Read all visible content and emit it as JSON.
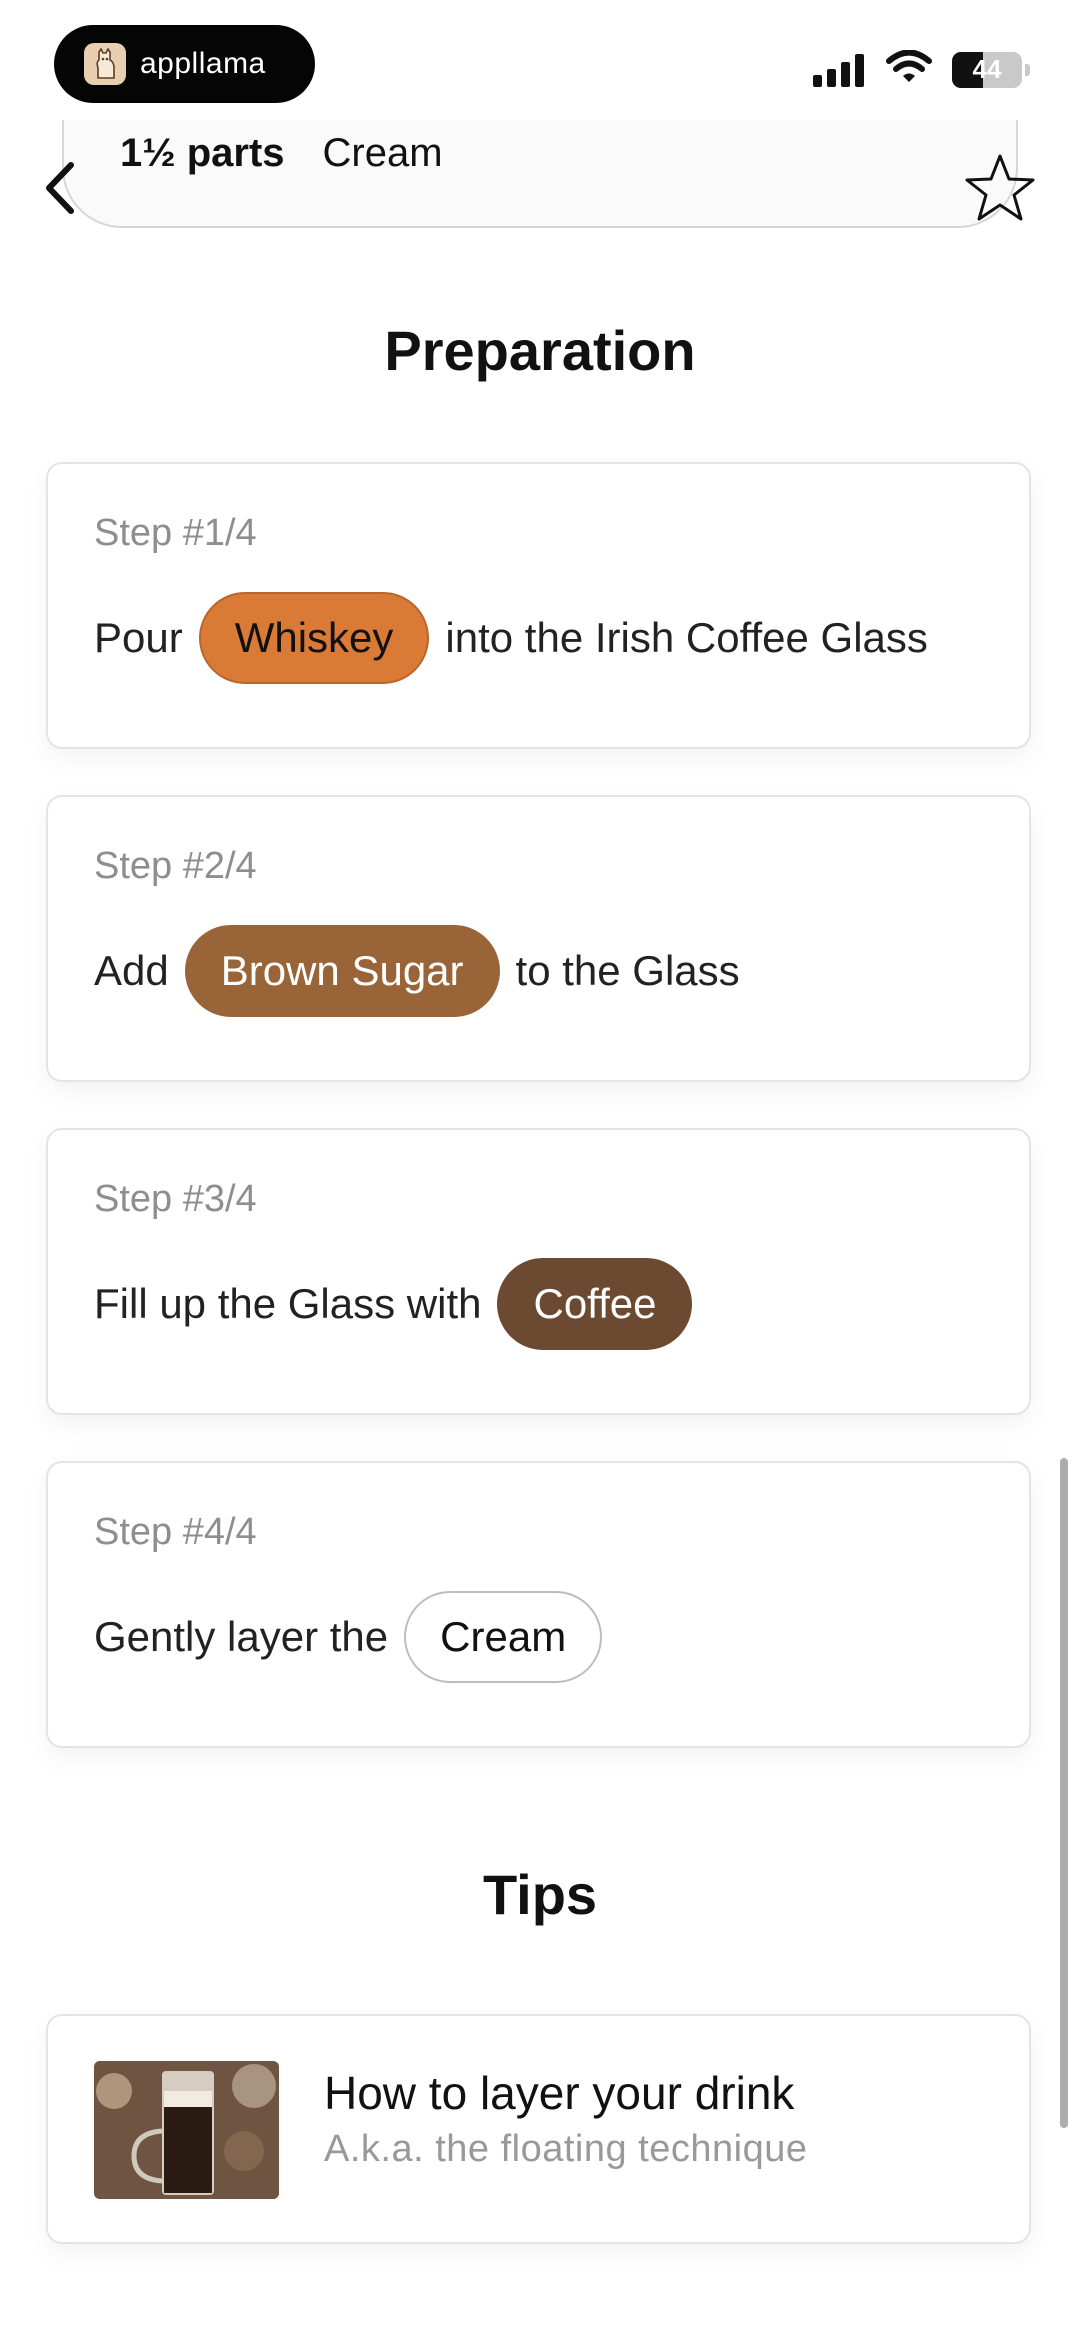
{
  "status_bar": {
    "app_name": "appllama",
    "battery": "44",
    "icons": [
      "cellular-signal-icon",
      "wifi-icon",
      "battery-icon"
    ]
  },
  "ingredient": {
    "amount": "1½ parts",
    "name": "Cream"
  },
  "nav": {
    "back_icon": "chevron-left-icon",
    "favorite_icon": "star-outline-icon"
  },
  "preparation": {
    "title": "Preparation",
    "steps": [
      {
        "label": "Step #1/4",
        "before": "Pour",
        "chip": "Whiskey",
        "after": "into the Irish Coffee Glass",
        "chip_bg": "#d97a36",
        "chip_fg": "#111111",
        "chip_border": "#b9652b"
      },
      {
        "label": "Step #2/4",
        "before": "Add",
        "chip": "Brown Sugar",
        "after": "to the Glass",
        "chip_bg": "#9a6439",
        "chip_fg": "#ffffff",
        "chip_border": "#9a6439"
      },
      {
        "label": "Step #3/4",
        "before": "Fill up the Glass with",
        "chip": "Coffee",
        "after": "",
        "chip_bg": "#6b4a31",
        "chip_fg": "#ffffff",
        "chip_border": "#6b4a31"
      },
      {
        "label": "Step #4/4",
        "before": "Gently layer the",
        "chip": "Cream",
        "after": "",
        "chip_bg": "#ffffff",
        "chip_fg": "#111111",
        "chip_border": "#bdbdbd"
      }
    ]
  },
  "tips": {
    "title": "Tips",
    "items": [
      {
        "title": "How to layer your drink",
        "subtitle": "A.k.a. the floating technique"
      }
    ]
  }
}
